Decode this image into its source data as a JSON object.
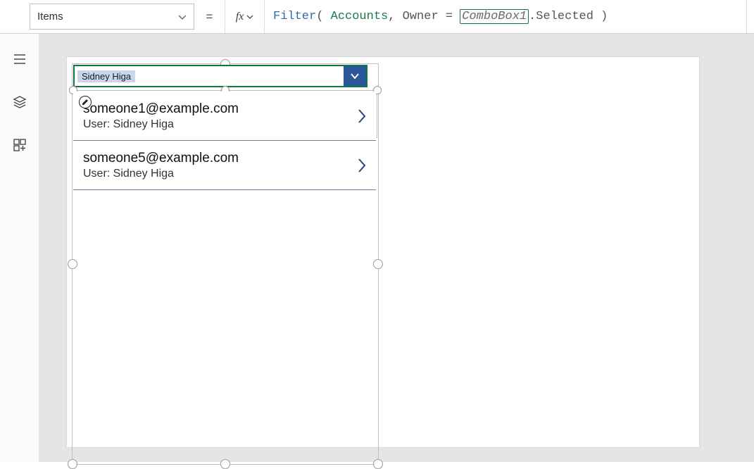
{
  "topbar": {
    "property_name": "Items",
    "equals": "=",
    "fx_label": "fx",
    "formula": {
      "func": "Filter",
      "datasource": "Accounts",
      "field": "Owner",
      "control_ref": "ComboBox1",
      "suffix": ".Selected"
    }
  },
  "leftrail": {
    "icons": [
      "hamburger-icon",
      "layers-icon",
      "insert-icon"
    ]
  },
  "canvas": {
    "combobox": {
      "selected_chip": "Sidney Higa"
    },
    "gallery": {
      "rows": [
        {
          "email": "someone1@example.com",
          "user_line": "User: Sidney Higa"
        },
        {
          "email": "someone5@example.com",
          "user_line": "User: Sidney Higa"
        }
      ]
    }
  }
}
